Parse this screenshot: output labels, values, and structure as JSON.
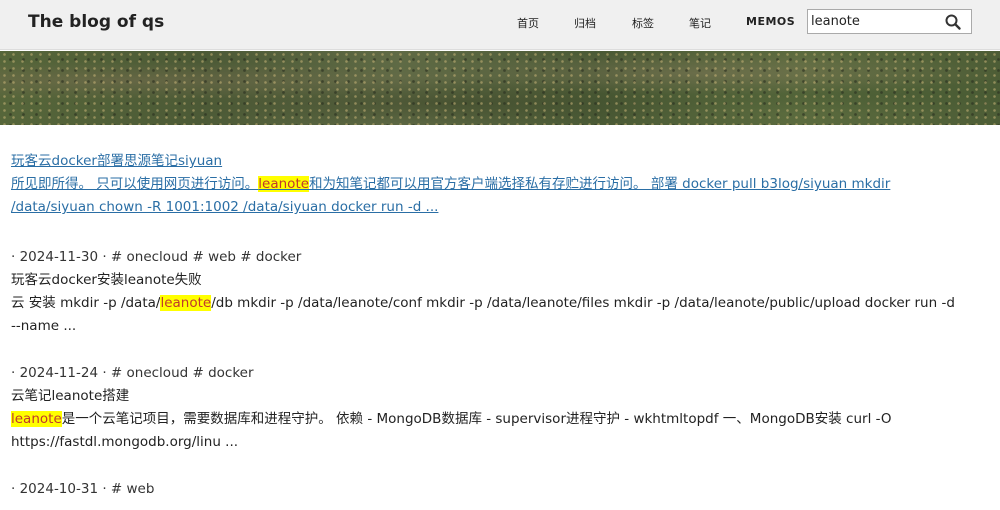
{
  "nav": {
    "brand": "The blog of qs",
    "links": [
      "首页",
      "归档",
      "标签",
      "笔记",
      "MEMOS"
    ],
    "search_value": "leanote"
  },
  "results": [
    {
      "title": "玩客云docker部署思源笔记siyuan",
      "line1_pre": "所见即所得。 只可以使用网页进行访问。",
      "line1_mark": "leanote",
      "line1_post": "和为知笔记都可以用官方客户端选择私有存贮进行访问。 部署 docker pull b3log/siyuan mkdir",
      "line2": "/data/siyuan chown -R 1001:1002 /data/siyuan docker run -d ..."
    },
    {
      "meta": "· 2024-11-30 · # onecloud # web # docker",
      "title": "玩客云docker安装leanote失败",
      "line1_pre": "云 安装 mkdir -p /data/",
      "line1_mark": "leanote",
      "line1_post": "/db mkdir -p /data/leanote/conf mkdir -p /data/leanote/files mkdir -p /data/leanote/public/upload docker run -d",
      "line2": "--name ..."
    },
    {
      "meta": "· 2024-11-24 · # onecloud # docker",
      "title": "云笔记leanote搭建",
      "line1_pre": "",
      "line1_mark": "leanote",
      "line1_post": "是一个云笔记项目，需要数据库和进程守护。 依赖 - MongoDB数据库 - supervisor进程守护 - wkhtmltopdf 一、MongoDB安装 curl -O",
      "line2": "https://fastdl.mongodb.org/linu ..."
    },
    {
      "meta": "· 2024-10-31 · # web"
    }
  ]
}
